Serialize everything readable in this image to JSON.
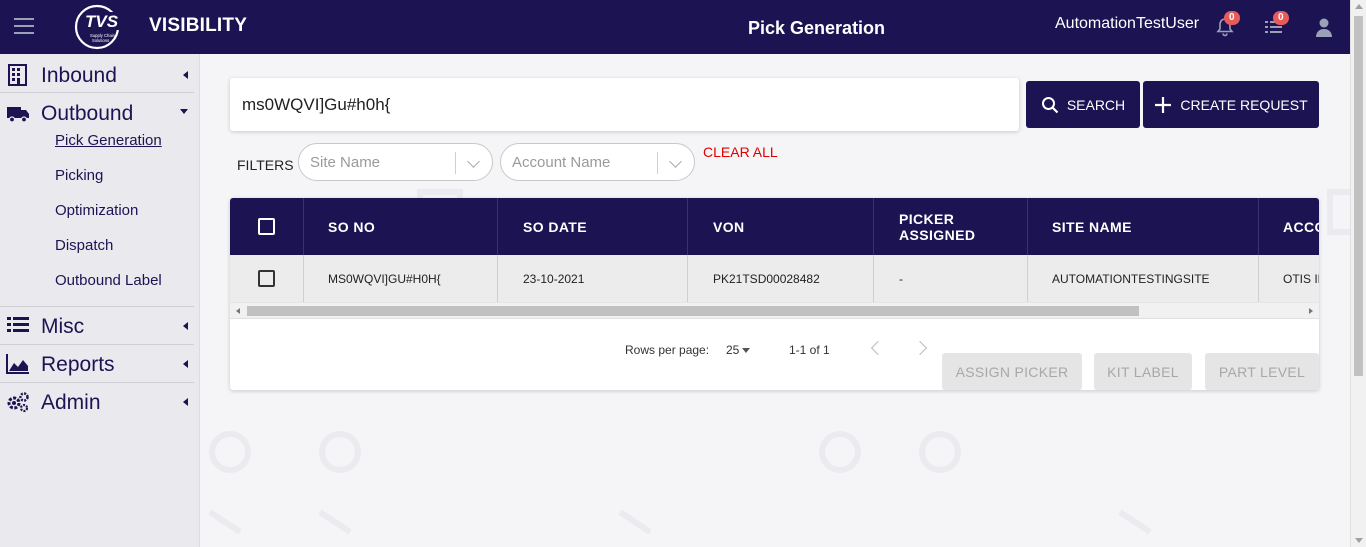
{
  "header": {
    "logo_text": "TVS",
    "logo_subtext": "Supply Chain Solutions",
    "brand": "VISIBILITY",
    "page_title": "Pick Generation",
    "username": "AutomationTestUser",
    "notifications_count": "0",
    "tasks_count": "0",
    "icons": [
      "menu-icon",
      "bell-icon",
      "list-icon",
      "user-icon"
    ]
  },
  "sidebar": {
    "groups": [
      {
        "label": "Inbound",
        "icon": "building-icon"
      },
      {
        "label": "Outbound",
        "icon": "truck-icon"
      },
      {
        "label": "Misc",
        "icon": "list-icon"
      },
      {
        "label": "Reports",
        "icon": "area-chart-icon"
      },
      {
        "label": "Admin",
        "icon": "gears-icon"
      }
    ],
    "outbound_items": [
      "Pick Generation",
      "Picking",
      "Optimization",
      "Dispatch",
      "Outbound Label"
    ]
  },
  "search": {
    "value": "ms0WQVI]Gu#h0h{",
    "search_label": "SEARCH",
    "create_label": "CREATE REQUEST"
  },
  "filters": {
    "label": "FILTERS",
    "site_placeholder": "Site Name",
    "account_placeholder": "Account Name",
    "clear_all": "CLEAR ALL"
  },
  "table": {
    "columns": [
      "SO NO",
      "SO DATE",
      "VON",
      "PICKER ASSIGNED",
      "SITE NAME",
      "ACCO"
    ],
    "picker_line1": "PICKER",
    "picker_line2": "ASSIGNED",
    "rows": [
      {
        "so_no": "MS0WQVI]GU#H0H{",
        "so_date": "23-10-2021",
        "von": "PK21TSD00028482",
        "picker": "-",
        "site": "AUTOMATIONTESTINGSITE",
        "account": "OTIS IN"
      }
    ]
  },
  "pagination": {
    "rows_per_page_label": "Rows per page:",
    "rows_per_page": "25",
    "range": "1-1 of 1"
  },
  "actions": {
    "assign_picker": "ASSIGN PICKER",
    "kit_label": "KIT LABEL",
    "part_level": "PART LEVEL"
  },
  "colors": {
    "primary": "#1c1452",
    "danger": "#e00000",
    "badge": "#e85b5b"
  }
}
